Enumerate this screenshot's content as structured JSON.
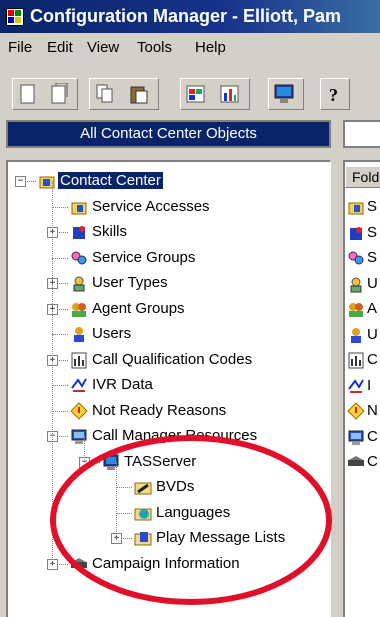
{
  "window": {
    "title": "Configuration Manager - Elliott, Pam"
  },
  "menu": [
    "File",
    "Edit",
    "View",
    "Tools",
    "Help"
  ],
  "toolbar": [
    "new-icon",
    "open-icon",
    "copy-icon",
    "paste-icon",
    "grid-icon",
    "chart-icon",
    "monitor-icon",
    "help-icon"
  ],
  "left_header": "All Contact Center Objects",
  "tree": [
    {
      "label": "Contact Center",
      "icon": "contact-center-icon",
      "depth": 0,
      "expander": "-",
      "selected": true
    },
    {
      "label": "Service Accesses",
      "icon": "service-access-icon",
      "depth": 1,
      "expander": ""
    },
    {
      "label": "Skills",
      "icon": "skills-icon",
      "depth": 1,
      "expander": "+"
    },
    {
      "label": "Service Groups",
      "icon": "service-group-icon",
      "depth": 1,
      "expander": ""
    },
    {
      "label": "User Types",
      "icon": "user-type-icon",
      "depth": 1,
      "expander": "+"
    },
    {
      "label": "Agent Groups",
      "icon": "agent-group-icon",
      "depth": 1,
      "expander": "+"
    },
    {
      "label": "Users",
      "icon": "users-icon",
      "depth": 1,
      "expander": ""
    },
    {
      "label": "Call Qualification Codes",
      "icon": "qualification-code-icon",
      "depth": 1,
      "expander": "+"
    },
    {
      "label": "IVR Data",
      "icon": "ivr-icon",
      "depth": 1,
      "expander": ""
    },
    {
      "label": "Not Ready Reasons",
      "icon": "not-ready-icon",
      "depth": 1,
      "expander": ""
    },
    {
      "label": "Call Manager Resources",
      "icon": "call-manager-icon",
      "depth": 1,
      "expander": "-"
    },
    {
      "label": "TASServer",
      "icon": "server-icon",
      "depth": 2,
      "expander": "-"
    },
    {
      "label": "BVDs",
      "icon": "bvd-icon",
      "depth": 3,
      "expander": ""
    },
    {
      "label": "Languages",
      "icon": "languages-icon",
      "depth": 3,
      "expander": ""
    },
    {
      "label": "Play Message Lists",
      "icon": "message-list-icon",
      "depth": 3,
      "expander": "+"
    },
    {
      "label": "Campaign Information",
      "icon": "campaign-icon",
      "depth": 1,
      "expander": "+"
    }
  ],
  "right_panel": {
    "column": "Fold",
    "items": [
      {
        "icon": "service-access-icon",
        "text": "S"
      },
      {
        "icon": "skills-icon",
        "text": "S"
      },
      {
        "icon": "service-group-icon",
        "text": "S"
      },
      {
        "icon": "user-type-icon",
        "text": "U"
      },
      {
        "icon": "agent-group-icon",
        "text": "A"
      },
      {
        "icon": "users-icon",
        "text": "U"
      },
      {
        "icon": "qualification-code-icon",
        "text": "C"
      },
      {
        "icon": "ivr-icon",
        "text": "I"
      },
      {
        "icon": "not-ready-icon",
        "text": "N"
      },
      {
        "icon": "call-manager-icon",
        "text": "C"
      },
      {
        "icon": "campaign-icon",
        "text": "C"
      }
    ]
  },
  "annotation_color": "#e0102a"
}
